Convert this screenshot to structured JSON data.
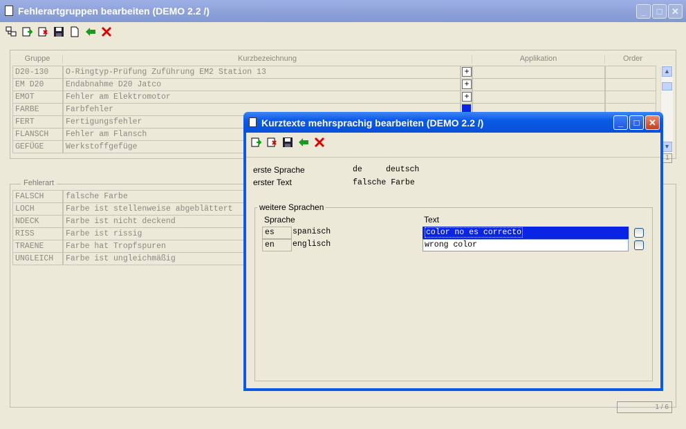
{
  "main_window": {
    "title": "Fehlerartgruppen bearbeiten (DEMO 2.2 /)",
    "top_group": {
      "headers": {
        "gruppe": "Gruppe",
        "kurz": "Kurzbezeichnung",
        "applikation": "Applikation",
        "order": "Order"
      },
      "rows": [
        {
          "code": "D20-130",
          "text": "O-Ringtyp-Prüfung Zuführung EM2 Station 13"
        },
        {
          "code": "EM D20",
          "text": "Endabnahme D20 Jatco"
        },
        {
          "code": "EMOT",
          "text": "Fehler am Elektromotor"
        },
        {
          "code": "FARBE",
          "text": "Farbfehler"
        },
        {
          "code": "FERT",
          "text": "Fertigungsfehler"
        },
        {
          "code": "FLANSCH",
          "text": "Fehler am Flansch"
        },
        {
          "code": "GEFÜGE",
          "text": "Werkstoffgefüge"
        }
      ],
      "plus_label": "+",
      "page_indicator": "1"
    },
    "bottom_group": {
      "legend": "Fehlerart",
      "rows": [
        {
          "code": "FALSCH",
          "text": "falsche Farbe"
        },
        {
          "code": "LOCH",
          "text": "Farbe ist stellenweise abgeblättert"
        },
        {
          "code": "NDECK",
          "text": "Farbe ist nicht deckend"
        },
        {
          "code": "RISS",
          "text": "Farbe ist rissig"
        },
        {
          "code": "TRAENE",
          "text": "Farbe hat Tropfspuren"
        },
        {
          "code": "UNGLEICH",
          "text": "Farbe ist ungleichmäßig"
        }
      ],
      "page_indicator": "1 / 6"
    }
  },
  "dialog": {
    "title": "Kurztexte mehrsprachig bearbeiten (DEMO 2.2 /)",
    "erste_sprache_label": "erste Sprache",
    "erste_sprache_code": "de",
    "erste_sprache_name": "deutsch",
    "erster_text_label": "erster Text",
    "erster_text_value": "falsche Farbe",
    "weitere_legend": "weitere Sprachen",
    "col_sprache": "Sprache",
    "col_text": "Text",
    "languages": [
      {
        "code": "es",
        "name": "spanisch",
        "text": "color no es correcto"
      },
      {
        "code": "en",
        "name": "englisch",
        "text": "wrong color"
      }
    ]
  },
  "colors": {
    "selection": "#0a24e6",
    "dialog_frame": "#0a58e6"
  }
}
